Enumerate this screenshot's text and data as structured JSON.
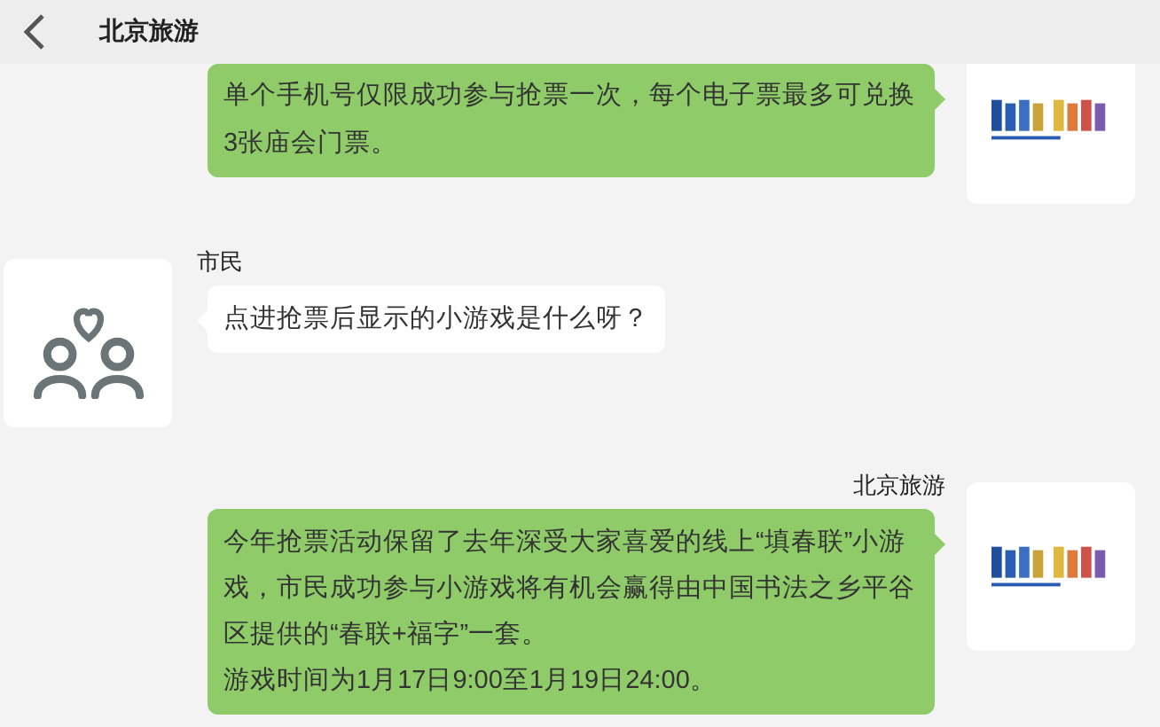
{
  "header": {
    "title": "北京旅游"
  },
  "messages": [
    {
      "kind": "outgoing",
      "paragraphs": [
        "单个手机号仅限成功参与抢票一次，每个电子票最多可兑换3张庙会门票。"
      ]
    },
    {
      "kind": "incoming",
      "sender": "市民",
      "paragraphs": [
        "点进抢票后显示的小游戏是什么呀？"
      ]
    },
    {
      "kind": "outgoing",
      "sender": "北京旅游",
      "paragraphs": [
        "今年抢票活动保留了去年深受大家喜爱的线上“填春联”小游戏，市民成功参与小游戏将有机会赢得由中国书法之乡平谷区提供的“春联+福字”一套。",
        "游戏时间为1月17日9:00至1月19日24:00。"
      ]
    }
  ]
}
